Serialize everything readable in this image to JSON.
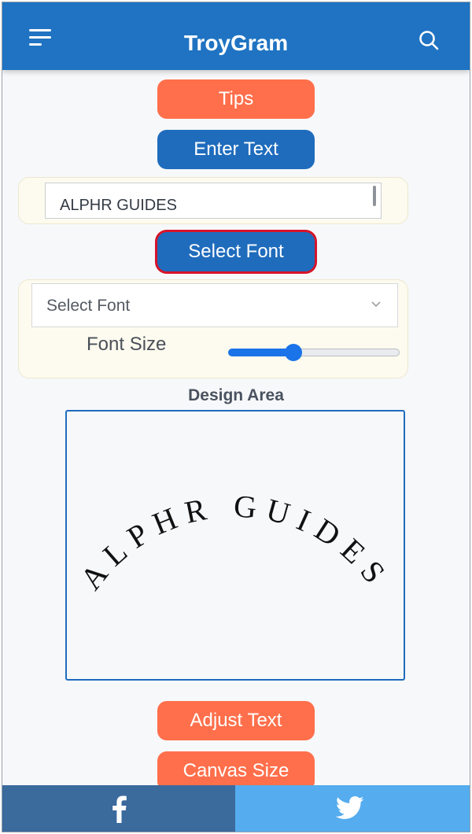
{
  "header": {
    "title": "TroyGram",
    "menu_icon": "menu-icon",
    "search_icon": "search-icon"
  },
  "buttons": {
    "tips": "Tips",
    "enter_text": "Enter Text",
    "select_font": "Select Font",
    "adjust_text": "Adjust Text",
    "canvas_size": "Canvas Size"
  },
  "text_input": {
    "value": "ALPHR GUIDES"
  },
  "font_panel": {
    "select_value": "Select Font",
    "font_size_label": "Font Size",
    "font_size_level": 0.38
  },
  "design": {
    "label": "Design Area",
    "curved_text": "ALPHR GUIDES"
  },
  "social": {
    "facebook_icon": "facebook-icon",
    "twitter_icon": "twitter-icon"
  },
  "colors": {
    "header_bg": "#1f73c2",
    "accent_orange": "#ff6f4b",
    "accent_blue": "#1f6cbd",
    "selected_border": "#d7142a",
    "facebook_bg": "#3b6a9d",
    "twitter_bg": "#55acee"
  }
}
